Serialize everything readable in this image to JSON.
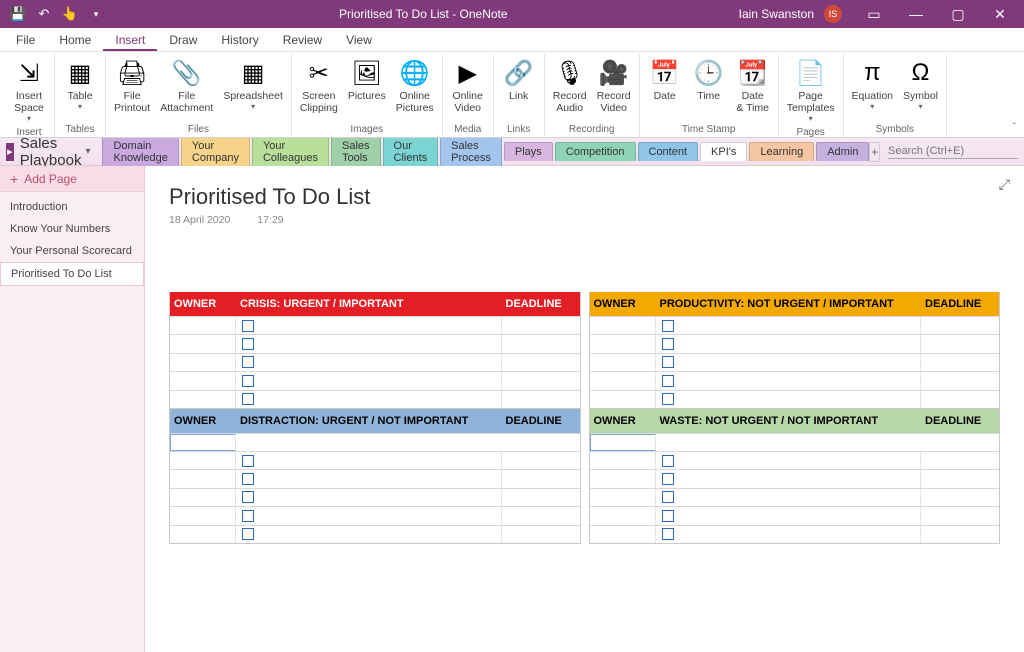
{
  "titlebar": {
    "title": "Prioritised To Do List  -  OneNote",
    "user": "Iain Swanston",
    "initials": "IS"
  },
  "menu": {
    "items": [
      "File",
      "Home",
      "Insert",
      "Draw",
      "History",
      "Review",
      "View"
    ],
    "active": "Insert"
  },
  "ribbon": {
    "groups": [
      {
        "label": "Insert",
        "items": [
          {
            "label": "Insert Space",
            "drop": true
          }
        ]
      },
      {
        "label": "Tables",
        "items": [
          {
            "label": "Table",
            "drop": true
          }
        ]
      },
      {
        "label": "Files",
        "items": [
          {
            "label": "File Printout"
          },
          {
            "label": "File Attachment"
          },
          {
            "label": "Spreadsheet",
            "drop": true
          }
        ]
      },
      {
        "label": "Images",
        "items": [
          {
            "label": "Screen Clipping"
          },
          {
            "label": "Pictures"
          },
          {
            "label": "Online Pictures"
          }
        ]
      },
      {
        "label": "Media",
        "items": [
          {
            "label": "Online Video"
          }
        ]
      },
      {
        "label": "Links",
        "items": [
          {
            "label": "Link"
          }
        ]
      },
      {
        "label": "Recording",
        "items": [
          {
            "label": "Record Audio"
          },
          {
            "label": "Record Video"
          }
        ]
      },
      {
        "label": "Time Stamp",
        "items": [
          {
            "label": "Date"
          },
          {
            "label": "Time"
          },
          {
            "label": "Date & Time"
          }
        ]
      },
      {
        "label": "Pages",
        "items": [
          {
            "label": "Page Templates",
            "drop": true
          }
        ]
      },
      {
        "label": "Symbols",
        "items": [
          {
            "label": "Equation",
            "drop": true
          },
          {
            "label": "Symbol",
            "drop": true
          }
        ]
      }
    ]
  },
  "notebook": {
    "name": "Sales Playbook",
    "sections": [
      {
        "label": "Domain Knowledge",
        "color": "#c9a9e0"
      },
      {
        "label": "Your Company",
        "color": "#f5d48a"
      },
      {
        "label": "Your Colleagues",
        "color": "#b8e09a"
      },
      {
        "label": "Sales Tools",
        "color": "#9fd0a8"
      },
      {
        "label": "Our Clients",
        "color": "#7bd4d4"
      },
      {
        "label": "Sales Process",
        "color": "#a3c4ec"
      },
      {
        "label": "Plays",
        "color": "#d9b6e0"
      },
      {
        "label": "Competition",
        "color": "#8fd4b8"
      },
      {
        "label": "Content",
        "color": "#8fc5e8"
      },
      {
        "label": "KPI's",
        "color": "#ffffff",
        "active": true
      },
      {
        "label": "Learning",
        "color": "#f5c6a1"
      },
      {
        "label": "Admin",
        "color": "#c5b0e0"
      }
    ],
    "search_placeholder": "Search (Ctrl+E)"
  },
  "sidebar": {
    "add_label": "Add Page",
    "pages": [
      "Introduction",
      "Know Your Numbers",
      "Your Personal Scorecard",
      "Prioritised To Do List"
    ],
    "selected": "Prioritised To Do List"
  },
  "page": {
    "title": "Prioritised To Do List",
    "date": "18 April 2020",
    "time": "17:29"
  },
  "quadrants": {
    "owner_label": "OWNER",
    "deadline_label": "DEADLINE",
    "q1": {
      "header": "CRISIS: URGENT / IMPORTANT",
      "rows": 5
    },
    "q2": {
      "header": "PRODUCTIVITY: NOT URGENT / IMPORTANT",
      "rows": 5
    },
    "q3": {
      "header": "DISTRACTION: URGENT / NOT IMPORTANT",
      "rows": 5
    },
    "q4": {
      "header": "WASTE: NOT URGENT / NOT IMPORTANT",
      "rows": 5
    }
  }
}
